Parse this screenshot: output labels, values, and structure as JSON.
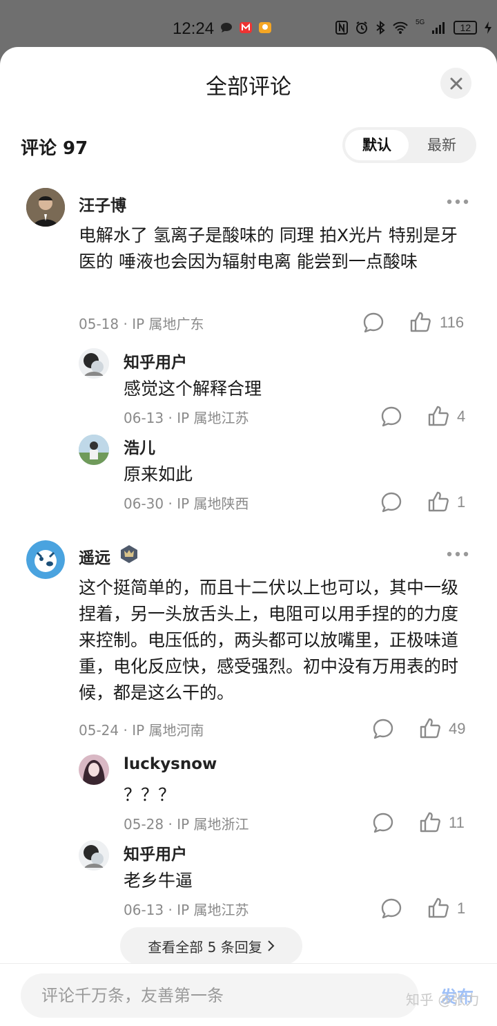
{
  "status_bar": {
    "time": "12:24",
    "network": "5G",
    "battery": "12"
  },
  "sheet": {
    "title": "全部评论"
  },
  "comments_header": {
    "count_label": "评论 97",
    "sort_default": "默认",
    "sort_latest": "最新"
  },
  "comments": [
    {
      "user": "汪子博",
      "text": "电解水了 氢离子是酸味的 同理 拍X光片 特别是牙医的 唾液也会因为辐射电离 能尝到一点酸味",
      "meta": "05-18 · IP 属地广东",
      "likes": "116",
      "replies": [
        {
          "user": "知乎用户",
          "text": "感觉这个解释合理",
          "meta": "06-13 · IP 属地江苏",
          "likes": "4"
        },
        {
          "user": "浩儿",
          "text": "原来如此",
          "meta": "06-30 · IP 属地陕西",
          "likes": "1"
        }
      ]
    },
    {
      "user": "遥远",
      "text": "这个挺简单的，而且十二伏以上也可以，其中一级捏着，另一头放舌头上，电阻可以用手捏的的力度来控制。电压低的，两头都可以放嘴里，正极味道重，电化反应快，感受强烈。初中没有万用表的时候，都是这么干的。",
      "meta": "05-24 · IP 属地河南",
      "likes": "49",
      "replies": [
        {
          "user": "luckysnow",
          "text": "？？？",
          "meta": "05-28 · IP 属地浙江",
          "likes": "11"
        },
        {
          "user": "知乎用户",
          "text": "老乡牛逼",
          "meta": "06-13 · IP 属地江苏",
          "likes": "1"
        }
      ]
    }
  ],
  "view_all": {
    "label": "查看全部 5 条回复"
  },
  "composer": {
    "placeholder": "评论千万条，友善第一条",
    "post_label": "发布",
    "watermark": "知乎 @张力"
  },
  "colors": {
    "accent": "#9fc0f7",
    "meta_gray": "#8a8a8a",
    "background_dim": "#6f6f6f"
  }
}
